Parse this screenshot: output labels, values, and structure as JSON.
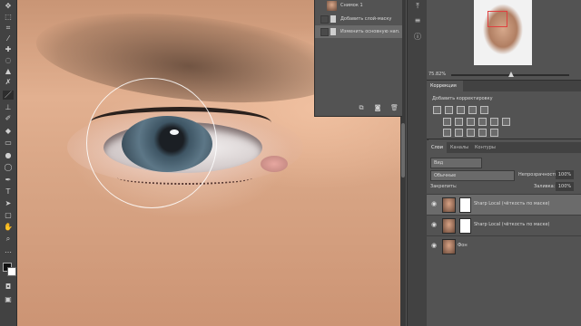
{
  "history": {
    "snapshot_label": "Снимок 1",
    "items": [
      {
        "label": "Добавить слой-маску",
        "selected": false
      },
      {
        "label": "Изменить основную нап...",
        "selected": true
      }
    ]
  },
  "navigator": {
    "zoom": "75.82%"
  },
  "adjustments": {
    "tab": "Коррекция",
    "subtitle": "Добавить корректировку"
  },
  "layers_panel": {
    "tabs": [
      "Слои",
      "Каналы",
      "Контуры"
    ],
    "active_tab": "Слои",
    "kind_filter": "Вид",
    "blend_mode": "Обычные",
    "opacity_label": "Непрозрачность:",
    "opacity_value": "100%",
    "lock_label": "Закрепить:",
    "fill_label": "Заливка:",
    "fill_value": "100%",
    "layers": [
      {
        "name": "Sharp Local (чёткость по маске)",
        "has_mask": true,
        "selected": true
      },
      {
        "name": "Sharp Local (чёткость по маске)",
        "has_mask": true,
        "selected": false
      },
      {
        "name": "Фон",
        "has_mask": false,
        "selected": false
      }
    ]
  },
  "colors": {
    "panel_bg": "#535353",
    "panel_dark": "#424242",
    "selected_row": "#6b6b6b",
    "navigator_view_box": "#e04040"
  }
}
